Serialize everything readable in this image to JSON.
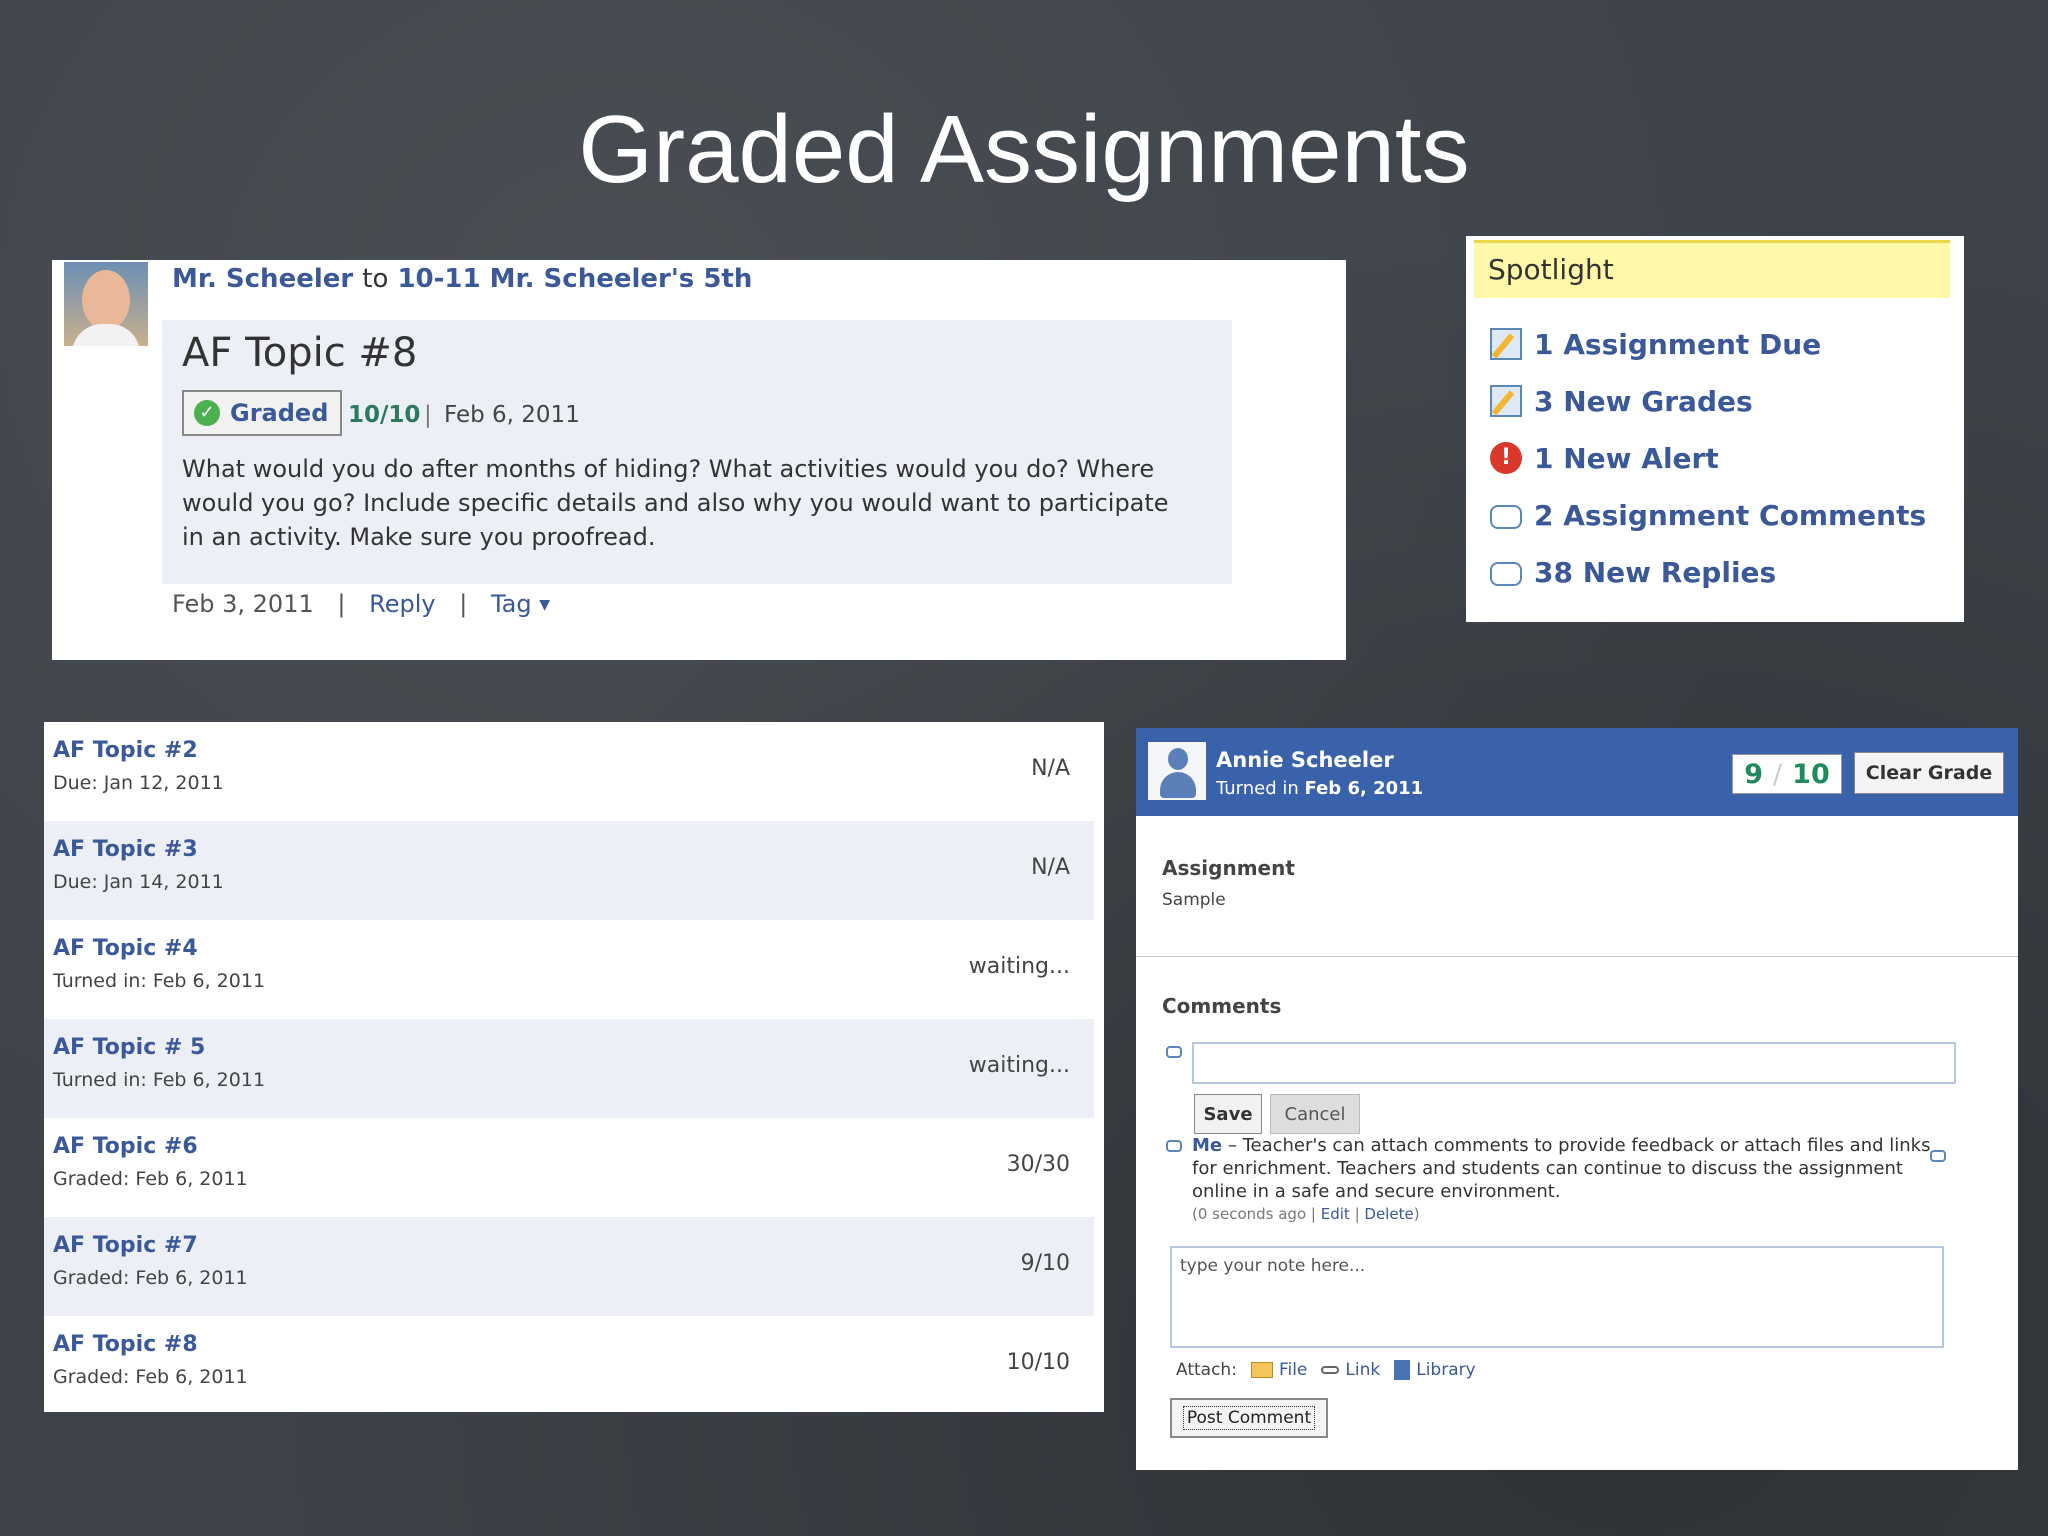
{
  "slide": {
    "title": "Graded Assignments"
  },
  "post": {
    "author": "Mr. Scheeler",
    "to_text": "to",
    "group": "10-11 Mr. Scheeler's 5th",
    "topic": "AF Topic #8",
    "badge": "Graded",
    "score": "10/10",
    "separator": "|",
    "date": "Feb 6, 2011",
    "body": "What would you do after months of hiding? What activities would you do? Where would you go? Include specific details and also why you would want to participate in an activity. Make sure you proofread.",
    "footer": {
      "date": "Feb 3, 2011",
      "sep": "|",
      "reply": "Reply",
      "tag": "Tag"
    }
  },
  "spotlight": {
    "header": "Spotlight",
    "items": [
      {
        "icon": "pencil-icon",
        "label": "1 Assignment Due"
      },
      {
        "icon": "pencil-icon",
        "label": "3 New Grades"
      },
      {
        "icon": "alert-icon",
        "label": "1 New Alert"
      },
      {
        "icon": "comment-icon",
        "label": "2 Assignment Comments"
      },
      {
        "icon": "comment-icon",
        "label": "38 New Replies"
      }
    ]
  },
  "assignments": [
    {
      "title": "AF Topic #2",
      "sub": "Due: Jan 12, 2011",
      "status": "N/A"
    },
    {
      "title": "AF Topic #3",
      "sub": "Due: Jan 14, 2011",
      "status": "N/A"
    },
    {
      "title": "AF Topic #4",
      "sub": "Turned in: Feb 6, 2011",
      "status": "waiting..."
    },
    {
      "title": "AF Topic # 5",
      "sub": "Turned in: Feb 6, 2011",
      "status": "waiting..."
    },
    {
      "title": "AF Topic #6",
      "sub": "Graded: Feb 6, 2011",
      "status": "30/30"
    },
    {
      "title": "AF Topic #7",
      "sub": "Graded: Feb 6, 2011",
      "status": "9/10"
    },
    {
      "title": "AF Topic #8",
      "sub": "Graded: Feb 6, 2011",
      "status": "10/10"
    }
  ],
  "grade_panel": {
    "student_name": "Annie Scheeler",
    "turned_in_label": "Turned in",
    "turned_in_date": "Feb 6, 2011",
    "grade_value": "9",
    "grade_slash": "/",
    "grade_max": "10",
    "clear_grade": "Clear Grade",
    "assignment_label": "Assignment",
    "assignment_value": "Sample",
    "comments_label": "Comments",
    "comment_input_value": "",
    "save": "Save",
    "cancel": "Cancel",
    "comment": {
      "author": "Me",
      "text": " – Teacher's can attach comments to provide feedback or attach files and links for enrichment. Teachers and students can continue to discuss the assignment online in a safe and secure environment.",
      "meta_prefix": "(0 seconds ago | ",
      "edit": "Edit",
      "meta_sep": " | ",
      "delete": "Delete",
      "meta_suffix": ")"
    },
    "note_placeholder": "type your note here...",
    "attach_label": "Attach:",
    "attach_file": "File",
    "attach_link": "Link",
    "attach_library": "Library",
    "post_comment": "Post Comment"
  },
  "colors": {
    "link_blue": "#3b5998",
    "header_blue": "#3a62ab",
    "spotlight_yellow": "#fff8a8",
    "grade_green": "#1e8a5e",
    "alert_red": "#d9382b"
  }
}
